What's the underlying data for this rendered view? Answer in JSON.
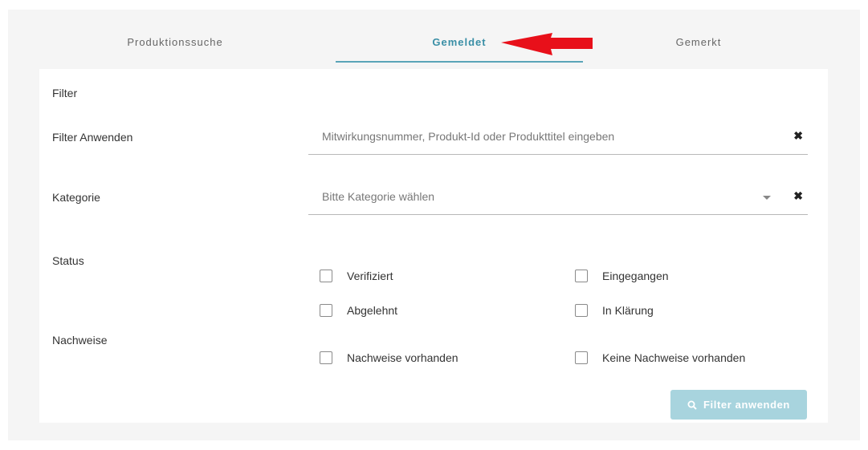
{
  "tabs": [
    {
      "label": "Produktionssuche",
      "active": false
    },
    {
      "label": "Gemeldet",
      "active": true
    },
    {
      "label": "Gemerkt",
      "active": false
    }
  ],
  "filter": {
    "heading": "Filter",
    "apply_label": "Filter Anwenden",
    "search_placeholder": "Mitwirkungsnummer, Produkt-Id oder Produkttitel eingeben",
    "clear_icon": "✖",
    "category_label": "Kategorie",
    "category_placeholder": "Bitte Kategorie wählen"
  },
  "status": {
    "label": "Status",
    "options": [
      "Verifiziert",
      "Eingegangen",
      "Abgelehnt",
      "In Klärung"
    ]
  },
  "nachweise": {
    "label": "Nachweise",
    "options": [
      "Nachweise vorhanden",
      "Keine Nachweise vorhanden"
    ]
  },
  "button": {
    "label": "Filter anwenden",
    "icon": "search-icon"
  },
  "colors": {
    "accent": "#3a8fa6",
    "arrow": "#e8101a",
    "button_disabled": "#a8d4de"
  }
}
